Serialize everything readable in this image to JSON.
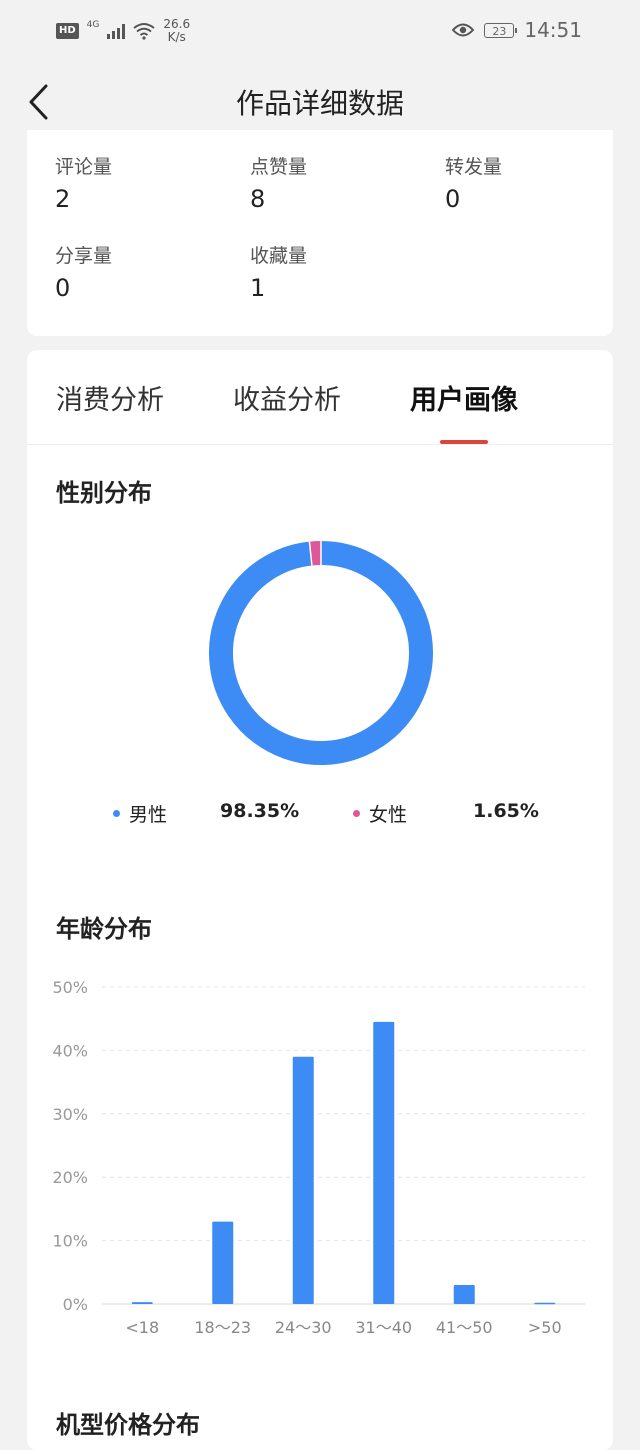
{
  "status_bar": {
    "hd": "HD",
    "network": "4G",
    "speed_value": "26.6",
    "speed_unit": "K/s",
    "battery": "23",
    "time": "14:51"
  },
  "nav": {
    "title": "作品详细数据"
  },
  "stats": [
    {
      "label": "评论量",
      "value": "2"
    },
    {
      "label": "点赞量",
      "value": "8"
    },
    {
      "label": "转发量",
      "value": "0"
    },
    {
      "label": "分享量",
      "value": "0"
    },
    {
      "label": "收藏量",
      "value": "1"
    }
  ],
  "tabs": [
    {
      "label": "消费分析"
    },
    {
      "label": "收益分析"
    },
    {
      "label": "用户画像",
      "active": true
    }
  ],
  "gender": {
    "title": "性别分布",
    "items": [
      {
        "label": "男性",
        "value": "98.35%",
        "color": "#3d8bf5"
      },
      {
        "label": "女性",
        "value": "1.65%",
        "color": "#e0569a"
      }
    ]
  },
  "age": {
    "title": "年龄分布"
  },
  "next_section_title": "机型价格分布",
  "chart_data": [
    {
      "type": "pie",
      "title": "性别分布",
      "categories": [
        "男性",
        "女性"
      ],
      "values": [
        98.35,
        1.65
      ],
      "colors": [
        "#3d8bf5",
        "#e0569a"
      ],
      "donut": true,
      "legend": "bottom"
    },
    {
      "type": "bar",
      "title": "年龄分布",
      "categories": [
        "<18",
        "18～23",
        "24～30",
        "31～40",
        "41～50",
        ">50"
      ],
      "values": [
        0.3,
        13,
        39,
        44.5,
        3,
        0.2
      ],
      "ylim": [
        0,
        50
      ],
      "yticks": [
        "0%",
        "10%",
        "20%",
        "30%",
        "40%",
        "50%"
      ],
      "color": "#3d8bf5",
      "grid": true
    }
  ]
}
